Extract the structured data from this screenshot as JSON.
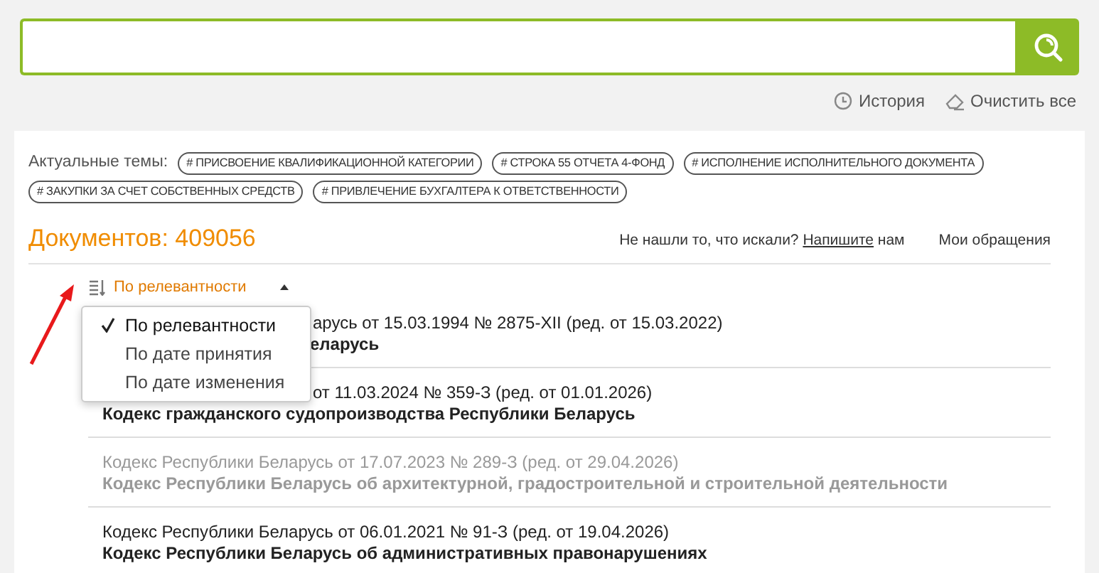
{
  "search_links": [
    {
      "kind": "history",
      "label": "История"
    },
    {
      "kind": "clear",
      "label": "Очистить все"
    }
  ],
  "topics": {
    "label": "Актуальные темы:",
    "tags": [
      "# ПРИСВОЕНИЕ КВАЛИФИКАЦИОННОЙ КАТЕГОРИИ",
      "# СТРОКА 55 ОТЧЕТА 4-ФОНД",
      "# ИСПОЛНЕНИЕ ИСПОЛНИТЕЛЬНОГО ДОКУМЕНТА",
      "# ЗАКУПКИ ЗА СЧЕТ СОБСТВЕННЫХ СРЕДСТВ",
      "# ПРИВЛЕЧЕНИЕ БУХГАЛТЕРА К ОТВЕТСТВЕННОСТИ"
    ]
  },
  "count": "Документов: 409056",
  "feedback": {
    "before": "Не нашли то, что искали?",
    "link": "Напишите",
    "after": "нам",
    "requests": "Мои обращения"
  },
  "sort": {
    "label": "По релевантности",
    "expanded": true,
    "options": [
      {
        "label": "По релевантности",
        "selected": true
      },
      {
        "label": "По дате принятия",
        "selected": false
      },
      {
        "label": "По дате изменения",
        "selected": false
      }
    ]
  },
  "documents": [
    {
      "meta": "арусь от 15.03.1994 № 2875-XII (ред. от 15.03.2022)",
      "meta_covered": true,
      "title": "еларусь",
      "title_covered": true,
      "outdated": false
    },
    {
      "meta": "от 11.03.2024 № 359-З (ред. от 01.01.2026)",
      "meta_covered": true,
      "title": "Кодекс гражданского судопроизводства Республики Беларусь",
      "title_covered": false,
      "outdated": false
    },
    {
      "meta": "Кодекс Республики Беларусь от 17.07.2023 № 289-З (ред. от 29.04.2026)",
      "meta_covered": false,
      "title": "Кодекс Республики Беларусь об архитектурной, градостроительной и строительной деятельности",
      "title_covered": false,
      "outdated": true
    },
    {
      "meta": "Кодекс Республики Беларусь от 06.01.2021 № 91-З (ред. от 19.04.2026)",
      "meta_covered": false,
      "title": "Кодекс Республики Беларусь об административных правонарушениях",
      "title_covered": false,
      "outdated": false
    }
  ]
}
